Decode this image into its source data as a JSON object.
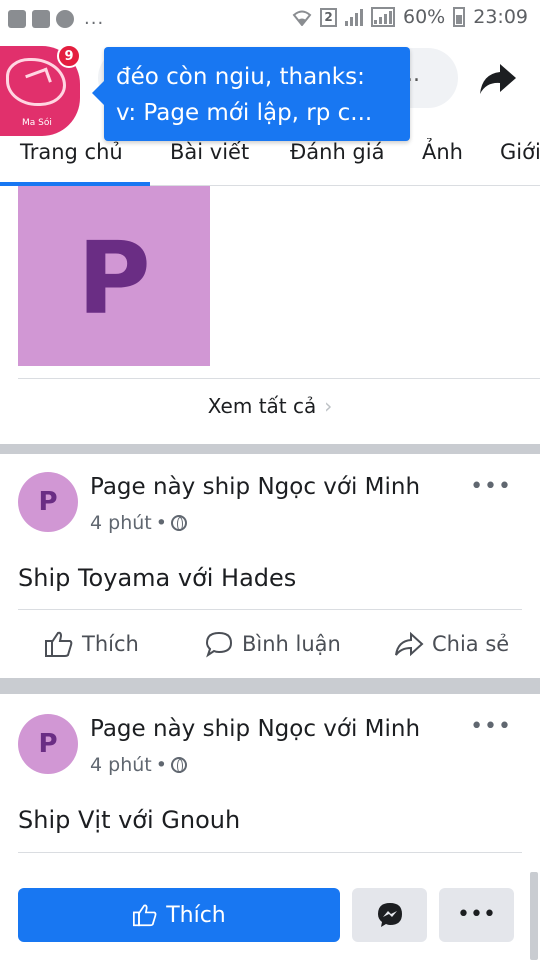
{
  "status_bar": {
    "dots": "...",
    "sim_label": "2",
    "battery": "60%",
    "time": "23:09"
  },
  "header": {
    "avatar_name": "Ma Sói",
    "notification_count": "9",
    "search_tail": "..",
    "bubble": {
      "line1": "đéo còn ngiu, thanks:",
      "line2": "v: Page mới lập, rp c..."
    }
  },
  "tabs": [
    "Trang chủ",
    "Bài viết",
    "Đánh giá",
    "Ảnh",
    "Giới"
  ],
  "photo": {
    "letter": "P"
  },
  "see_all": {
    "label": "Xem tất cả",
    "chevron": "›"
  },
  "posts": [
    {
      "avatar_letter": "P",
      "author": "Page này ship Ngọc với Minh",
      "time": "4 phút",
      "sep": "•",
      "more": "•••",
      "text": "Ship Toyama với Hades"
    },
    {
      "avatar_letter": "P",
      "author": "Page này ship Ngọc với Minh",
      "time": "4 phút",
      "sep": "•",
      "more": "•••",
      "text": "Ship Vịt với Gnouh"
    }
  ],
  "actions": {
    "like": "Thích",
    "comment": "Bình luận",
    "share": "Chia sẻ"
  },
  "bottom_bar": {
    "like_label": "Thích",
    "more_label": "•••"
  },
  "colors": {
    "brand_blue": "#1877f2",
    "page_avatar": "#d197d4",
    "page_letter": "#6a2d84",
    "divider": "#c9ccd1"
  }
}
